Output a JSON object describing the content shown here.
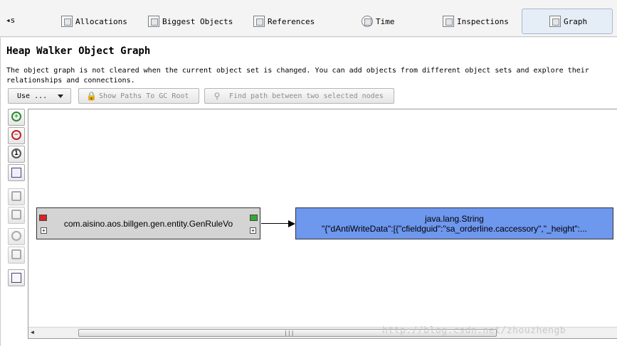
{
  "tabs": [
    {
      "label": "Allocations",
      "icon": "allocations-icon"
    },
    {
      "label": "Biggest Objects",
      "icon": "biggest-objects-icon"
    },
    {
      "label": "References",
      "icon": "references-icon"
    },
    {
      "label": "Time",
      "icon": "time-icon"
    },
    {
      "label": "Inspections",
      "icon": "inspections-icon"
    },
    {
      "label": "Graph",
      "icon": "graph-icon",
      "active": true
    }
  ],
  "tab_scroll_label": "s",
  "title": "Heap Walker Object Graph",
  "description": "The object graph is not cleared when the current object set is changed. You can add objects from different object sets and explore their relationships and connections.",
  "toolbar": {
    "use_label": "Use ...",
    "show_paths_label": "Show Paths To GC Root",
    "find_path_label": "Find path between two selected nodes"
  },
  "side_tools": [
    "zoom-in-icon",
    "zoom-out-icon",
    "zoom-reset-icon",
    "fit-to-window-icon",
    "back-icon",
    "forward-icon",
    "stop-icon",
    "delete-icon",
    "layout-icon"
  ],
  "graph": {
    "nodes": [
      {
        "label": "com.aisino.aos.billgen.gen.entity.GenRuleVo",
        "color": "#d4d4d4"
      },
      {
        "label": "java.lang.String",
        "detail": "\"{\"dAntiWriteData\":[{\"cfieldguid\":\"sa_orderline.caccessory\",\"_height\":...",
        "color": "#6e97ee"
      }
    ]
  },
  "watermark": "http://blog.csdn.net/zhouzhengb"
}
